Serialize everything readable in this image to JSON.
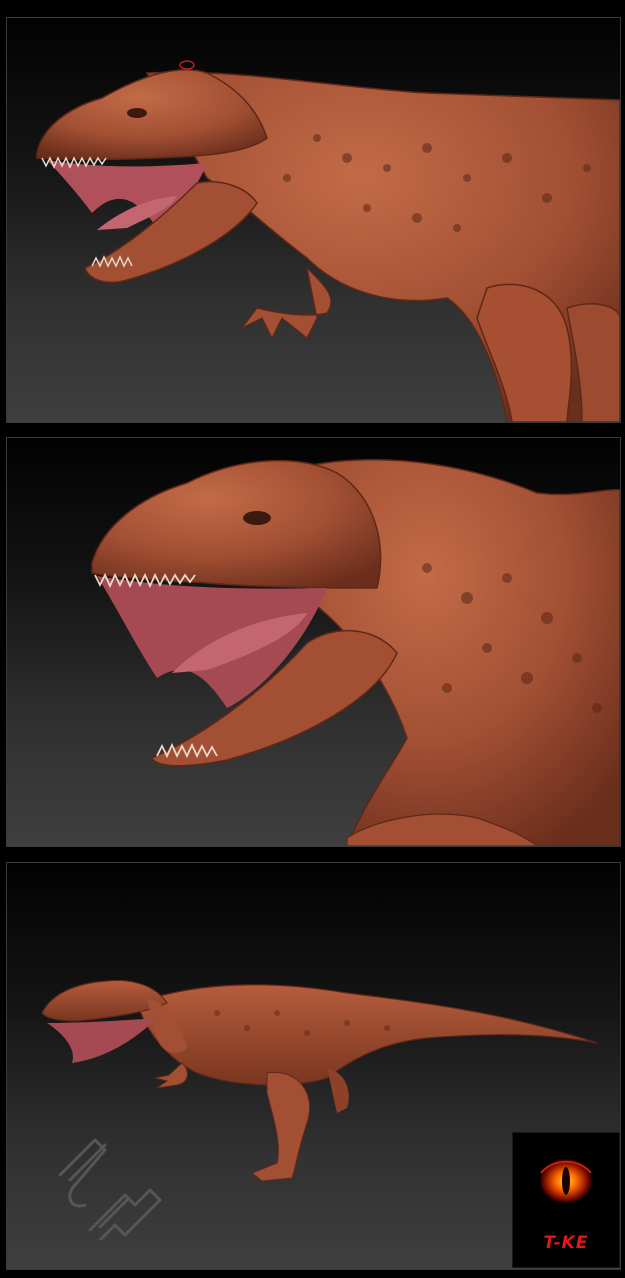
{
  "panels": [
    {
      "view": "closeup-profile",
      "subject": "dinosaur-sculpt"
    },
    {
      "view": "extreme-closeup-head",
      "subject": "dinosaur-sculpt"
    },
    {
      "view": "full-body",
      "subject": "dinosaur-sculpt"
    }
  ],
  "colors": {
    "skin": "#a24f33",
    "skin_dark": "#6a2e1c",
    "skin_light": "#c26b48",
    "mouth": "#b0505a",
    "background_top": "#020202",
    "background_bottom": "#3f3f3f",
    "logo_red": "#e01818"
  },
  "signature": {
    "text": "JW"
  },
  "logo": {
    "text": "T-KE"
  }
}
